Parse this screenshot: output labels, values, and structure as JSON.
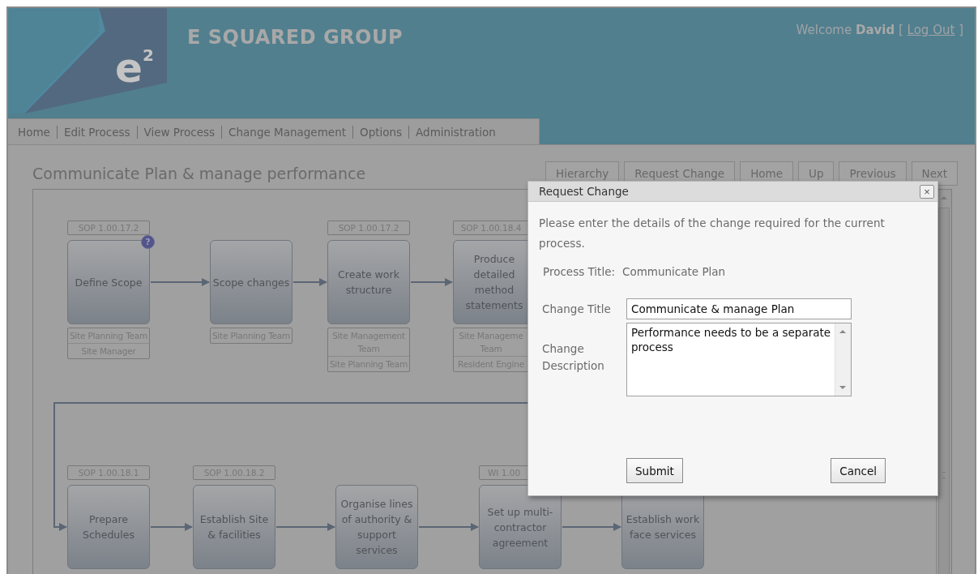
{
  "header": {
    "logo_text": "e$^{2}$",
    "company": "E SQUARED GROUP",
    "welcome": "Welcome **David** [",
    "logout": "Log Out",
    "welcome_end": "]"
  },
  "nav": [
    {
      "label": "Home"
    },
    {
      "label": "Edit Process"
    },
    {
      "label": "View Process"
    },
    {
      "label": "Change Management"
    },
    {
      "label": "Options"
    },
    {
      "label": "Administration"
    }
  ],
  "page_title": "Communicate Plan & manage performance",
  "toolbar": [
    "Hierarchy",
    "Request Change",
    "Home",
    "Up",
    "Previous",
    "Next"
  ],
  "diagram": {
    "rows": [
      {
        "nodes": [
          {
            "code": "SOP 1.00.17.2",
            "title": "Define Scope",
            "help": "?",
            "teams": [
              "Site Planning Team",
              "Site Manager"
            ]
          },
          {
            "title": "Scope changes",
            "teams": [
              "Site Planning Team"
            ]
          },
          {
            "code": "SOP 1.00.17.2",
            "title": "Create work structure",
            "teams": [
              "Site Management Team",
              "Site Planning Team"
            ]
          },
          {
            "code": "SOP 1.00.18.4",
            "title": "Produce detailed method statements",
            "teams": [
              "Site Manageme Team",
              "Resident Engine"
            ]
          }
        ]
      },
      {
        "nodes": [
          {
            "code": "SOP 1.00.18.1",
            "title": "Prepare Schedules"
          },
          {
            "code": "SOP 1.00.18.2",
            "title": "Establish Site & facilities"
          },
          {
            "title": "Organise lines of authority & support services"
          },
          {
            "code": "WI 1.00",
            "title": "Set up multi-contractor agreement"
          },
          {
            "title": "Establish work face services"
          }
        ]
      }
    ]
  },
  "dialog": {
    "title": "Request Change",
    "close": "×",
    "intro": "Please enter the details of the change required for the current process.",
    "process_label": "Process Title:",
    "process_value": "Communicate Plan",
    "change_title_label": "Change Title",
    "change_title_value": "Communicate & manage Plan",
    "description_label": "Change Description",
    "description_value": "Performance needs to be a separate process",
    "buttons": [
      "Submit",
      "Cancel"
    ]
  }
}
